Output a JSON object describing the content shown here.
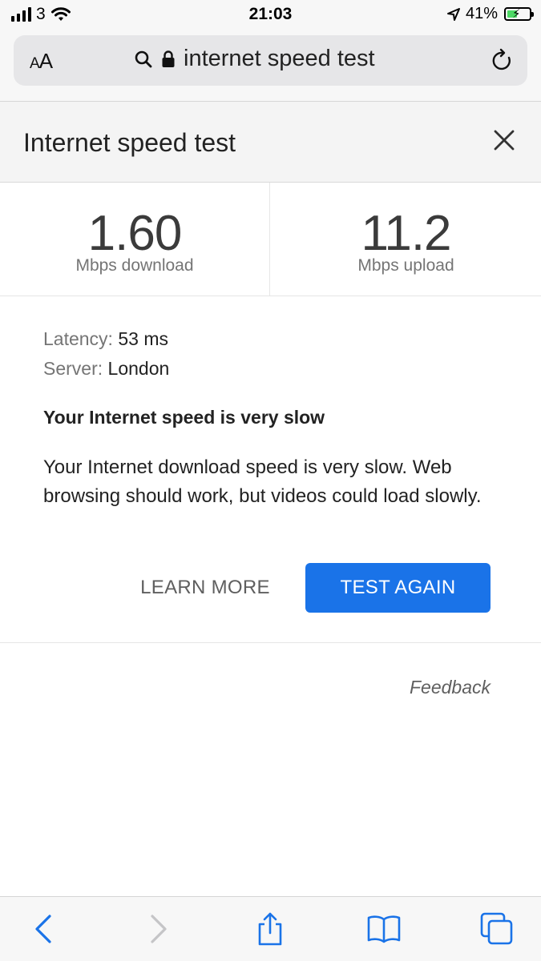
{
  "status_bar": {
    "carrier": "3",
    "time": "21:03",
    "battery_percent": "41%",
    "battery_level": 0.41,
    "icons": [
      "signal-icon",
      "wifi-icon",
      "location-icon",
      "battery-charging-icon"
    ]
  },
  "browser": {
    "text_size_label": "AA",
    "url_text": "internet speed test",
    "icons": [
      "search-icon",
      "lock-icon",
      "reload-icon"
    ]
  },
  "panel": {
    "title": "Internet speed test"
  },
  "results": {
    "download_value": "1.60",
    "download_label": "Mbps download",
    "upload_value": "11.2",
    "upload_label": "Mbps upload"
  },
  "details": {
    "latency_key": "Latency:",
    "latency_value": "53 ms",
    "server_key": "Server:",
    "server_value": "London"
  },
  "verdict": {
    "heading": "Your Internet speed is very slow",
    "body": "Your Internet download speed is very slow. Web browsing should work, but videos could load slowly."
  },
  "actions": {
    "learn_more": "LEARN MORE",
    "test_again": "TEST AGAIN"
  },
  "feedback_label": "Feedback",
  "colors": {
    "accent": "#1a73e8",
    "battery_fill": "#4cd964",
    "toolbar_icons": "#1a73e8"
  },
  "toolbar": {
    "icons": [
      "back-icon",
      "forward-icon",
      "share-icon",
      "bookmarks-icon",
      "tabs-icon"
    ]
  }
}
